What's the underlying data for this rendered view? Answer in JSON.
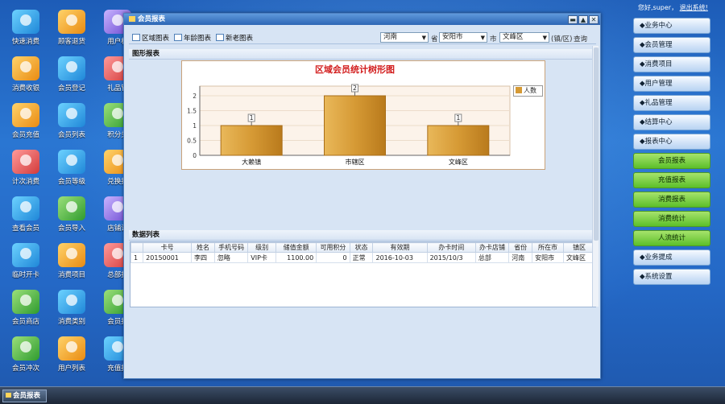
{
  "desktop": {
    "icons": [
      {
        "label": "快速消费"
      },
      {
        "label": "顾客退货"
      },
      {
        "label": "用户权"
      },
      {
        "label": "消费收银"
      },
      {
        "label": "会员登记"
      },
      {
        "label": "礼品管"
      },
      {
        "label": "会员充值"
      },
      {
        "label": "会员列表"
      },
      {
        "label": "积分兑"
      },
      {
        "label": "计次消费"
      },
      {
        "label": "会员等级"
      },
      {
        "label": "兑换报"
      },
      {
        "label": "查看会员"
      },
      {
        "label": "会员导入"
      },
      {
        "label": "店铺设"
      },
      {
        "label": "临时开卡"
      },
      {
        "label": "消费项目"
      },
      {
        "label": "总部报"
      },
      {
        "label": "会员商店"
      },
      {
        "label": "消费类别"
      },
      {
        "label": "会员报"
      },
      {
        "label": "会员冲次"
      },
      {
        "label": "用户列表"
      },
      {
        "label": "充值报"
      }
    ]
  },
  "window": {
    "title": "会员报表",
    "buttons": {
      "minimize": "▬",
      "maximize": "▲",
      "close": "✕"
    }
  },
  "toolbar": {
    "region_chart": "区域图表",
    "age_chart": "年龄图表",
    "new_old_chart": "新老图表",
    "province_value": "河南",
    "province_label": "省",
    "city_value": "安阳市",
    "city_label": "市",
    "district_value": "文峰区",
    "district_label": "(镇/区)",
    "query": "查询"
  },
  "chart_panel": {
    "header": "图形报表"
  },
  "chart_data": {
    "type": "bar",
    "title": "区域会员统计树形图",
    "categories": [
      "大赖镇",
      "市辖区",
      "文峰区"
    ],
    "series": [
      {
        "name": "人数",
        "values": [
          1,
          2,
          1
        ]
      }
    ],
    "data_labels": [
      "1",
      "2",
      "1"
    ],
    "yticks": [
      "0",
      "0.5",
      "1",
      "1.5",
      "2"
    ],
    "ylim": [
      0,
      2
    ],
    "legend": "right",
    "bar_color": "#d69a35"
  },
  "data_panel": {
    "header": "数据列表",
    "columns": [
      "",
      "卡号",
      "姓名",
      "手机号码",
      "级别",
      "储值金额",
      "可用积分",
      "状态",
      "有效期",
      "办卡时间",
      "办卡店铺",
      "省份",
      "所在市",
      "镇区"
    ],
    "rows": [
      [
        "1",
        "20150001",
        "李四",
        "忽略",
        "VIP卡",
        "1100.00",
        "0",
        "正常",
        "2016-10-03",
        "2015/10/3",
        "总部",
        "河南",
        "安阳市",
        "文峰区"
      ]
    ]
  },
  "sidebar": {
    "greeting": "您好,super，",
    "logout": "退出系统!",
    "items": [
      {
        "label": "◆业务中心"
      },
      {
        "label": "◆会员管理"
      },
      {
        "label": "◆消费项目"
      },
      {
        "label": "◆用户管理"
      },
      {
        "label": "◆礼品管理"
      },
      {
        "label": "◆结算中心"
      },
      {
        "label": "◆报表中心"
      }
    ],
    "subitems": [
      {
        "label": "会员报表"
      },
      {
        "label": "充值报表"
      },
      {
        "label": "消费报表"
      },
      {
        "label": "消费统计"
      },
      {
        "label": "人流统计"
      }
    ],
    "bottom_items": [
      {
        "label": "◆业务提成"
      },
      {
        "label": "◆系统设置"
      }
    ]
  },
  "taskbar": {
    "item": "会员报表"
  }
}
